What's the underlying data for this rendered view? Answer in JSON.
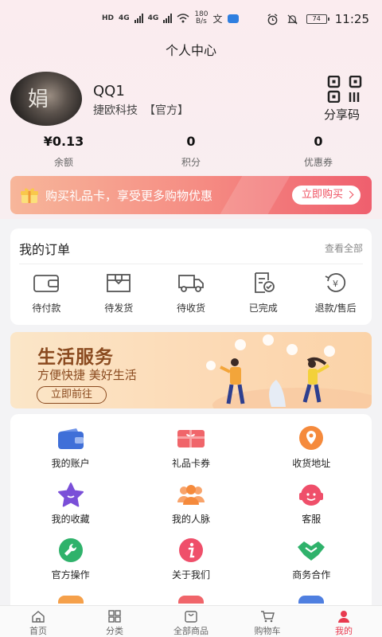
{
  "status_bar": {
    "network_badge": "HD",
    "network_type": "4G",
    "speed_value": "180",
    "speed_unit": "B/s",
    "battery": "74",
    "time": "11:25"
  },
  "header": {
    "title": "个人中心"
  },
  "profile": {
    "avatar_text": "娟",
    "name": "QQ1",
    "company": "捷欧科技",
    "tag": "【官方】",
    "share_label": "分享码"
  },
  "stats": [
    {
      "value": "¥0.13",
      "label": "余额"
    },
    {
      "value": "0",
      "label": "积分"
    },
    {
      "value": "0",
      "label": "优惠券"
    }
  ],
  "promo": {
    "text": "购买礼品卡，享受更多购物优惠",
    "button": "立即购买"
  },
  "orders": {
    "title": "我的订单",
    "more": "查看全部",
    "items": [
      {
        "label": "待付款",
        "icon": "wallet-icon"
      },
      {
        "label": "待发货",
        "icon": "box-icon"
      },
      {
        "label": "待收货",
        "icon": "truck-icon"
      },
      {
        "label": "已完成",
        "icon": "completed-doc-icon"
      },
      {
        "label": "退款/售后",
        "icon": "refund-icon"
      }
    ]
  },
  "life_banner": {
    "title": "生活服务",
    "subtitle": "方便快捷 美好生活",
    "button": "立即前往"
  },
  "services": [
    {
      "label": "我的账户",
      "icon": "wallet-icon",
      "color": "#3f6fd8"
    },
    {
      "label": "礼品卡券",
      "icon": "gift-card-icon",
      "color": "#f0656a"
    },
    {
      "label": "收货地址",
      "icon": "location-icon",
      "color": "#f58a3c"
    },
    {
      "label": "我的收藏",
      "icon": "star-icon",
      "color": "#7a4fd8"
    },
    {
      "label": "我的人脉",
      "icon": "people-icon",
      "color": "#f58a3c"
    },
    {
      "label": "客服",
      "icon": "customer-service-icon",
      "color": "#ef4f6a"
    },
    {
      "label": "官方操作",
      "icon": "wrench-icon",
      "color": "#2fb26b"
    },
    {
      "label": "关于我们",
      "icon": "info-icon",
      "color": "#ef4f6a"
    },
    {
      "label": "商务合作",
      "icon": "handshake-icon",
      "color": "#2fb26b"
    }
  ],
  "tabbar": [
    {
      "label": "首页",
      "icon": "home-icon",
      "active": false
    },
    {
      "label": "分类",
      "icon": "category-icon",
      "active": false
    },
    {
      "label": "全部商品",
      "icon": "shop-bag-icon",
      "active": false
    },
    {
      "label": "购物车",
      "icon": "cart-icon",
      "active": false
    },
    {
      "label": "我的",
      "icon": "user-icon",
      "active": true
    }
  ],
  "colors": {
    "accent": "#e83a4f",
    "page_bg": "#f3f3f5",
    "header_bg": "#fbecef"
  }
}
